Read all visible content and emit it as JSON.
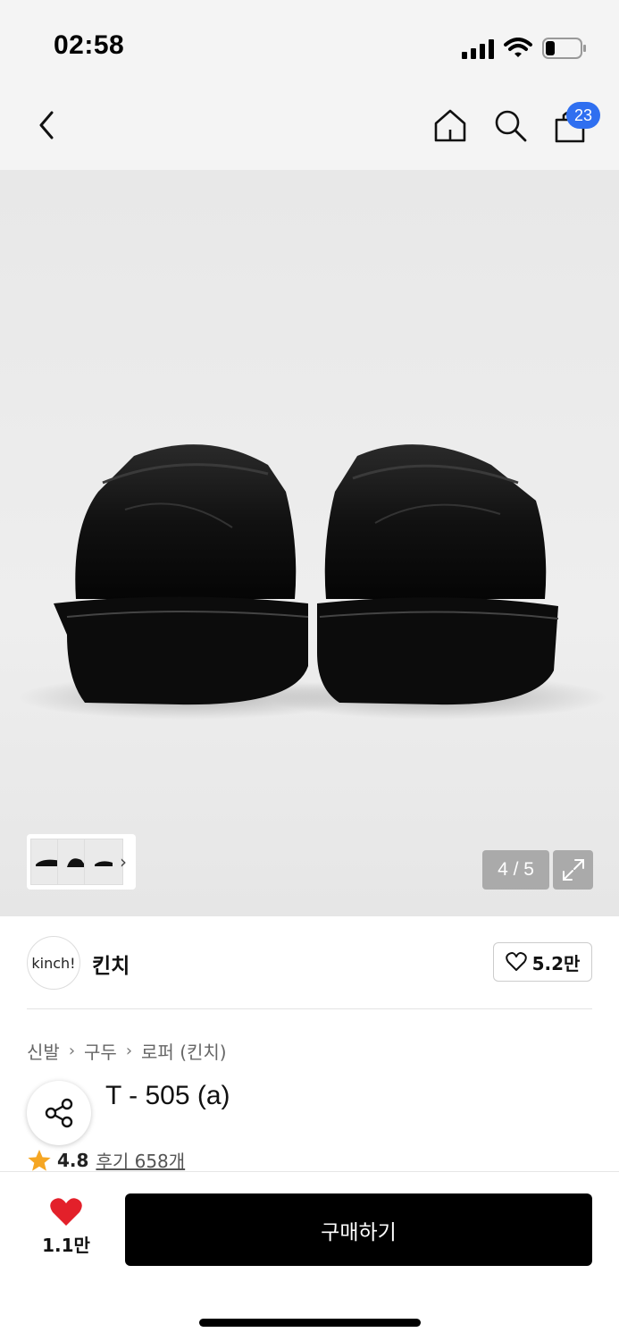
{
  "status_bar": {
    "time": "02:58"
  },
  "nav": {
    "cart_count": "23",
    "icons": [
      "back-icon",
      "home-icon",
      "search-icon",
      "cart-icon"
    ]
  },
  "gallery": {
    "page_counter": "4 / 5",
    "current_index": 4,
    "total": 5
  },
  "brand": {
    "logo_text": "kinch!",
    "name": "킨치",
    "likes": "5.2만"
  },
  "breadcrumb": [
    "신발",
    "구두",
    "로퍼 (킨치)"
  ],
  "product": {
    "title_visible": "T - 505 (a)",
    "rating": "4.8",
    "reviews": "후기 658개"
  },
  "bottom_bar": {
    "wish_count": "1.1만",
    "buy_label": "구매하기"
  },
  "colors": {
    "accent": "#2f6ff0",
    "heart": "#e3202a",
    "star": "#f5a623",
    "buy_button": "#000000"
  }
}
